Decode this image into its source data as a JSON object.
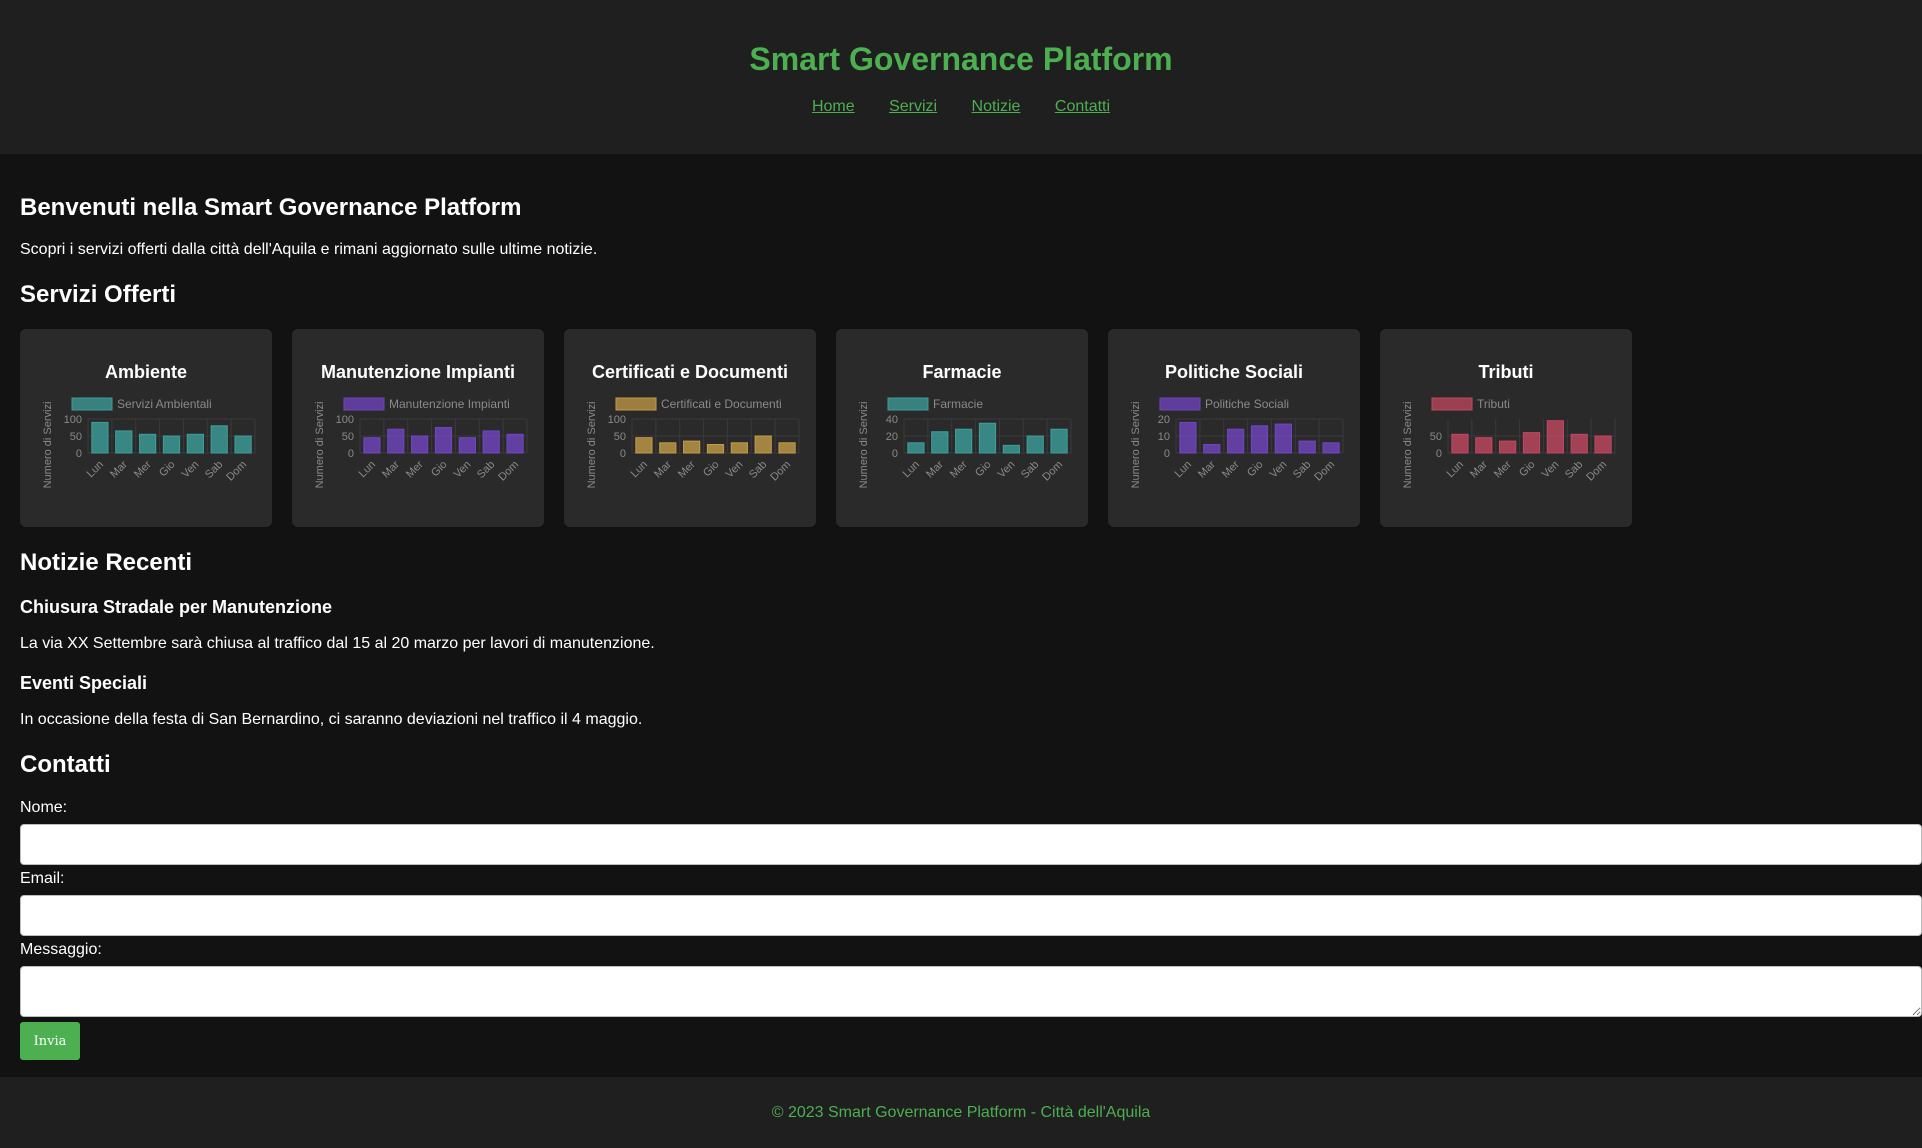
{
  "header": {
    "title": "Smart Governance Platform",
    "nav": [
      "Home",
      "Servizi",
      "Notizie",
      "Contatti"
    ]
  },
  "welcome": {
    "title": "Benvenuti nella Smart Governance Platform",
    "text": "Scopri i servizi offerti dalla città dell'Aquila e rimani aggiornato sulle ultime notizie."
  },
  "services": {
    "title": "Servizi Offerti",
    "cards": [
      {
        "title": "Ambiente"
      },
      {
        "title": "Manutenzione Impianti"
      },
      {
        "title": "Certificati e Documenti"
      },
      {
        "title": "Farmacie"
      },
      {
        "title": "Politiche Sociali"
      },
      {
        "title": "Tributi"
      }
    ]
  },
  "chart_data": [
    {
      "type": "bar",
      "title": "",
      "ylabel": "Numero di Servizi",
      "categories": [
        "Lun",
        "Mar",
        "Mer",
        "Gio",
        "Ven",
        "Sab",
        "Dom"
      ],
      "series": [
        {
          "name": "Servizi Ambientali",
          "values": [
            90,
            65,
            55,
            50,
            55,
            80,
            50
          ]
        }
      ],
      "yticks": [
        0,
        50,
        100
      ],
      "ylim": [
        0,
        100
      ],
      "color": "#3d9f9b"
    },
    {
      "type": "bar",
      "title": "",
      "ylabel": "Numero di Servizi",
      "categories": [
        "Lun",
        "Mar",
        "Mer",
        "Gio",
        "Ven",
        "Sab",
        "Dom"
      ],
      "series": [
        {
          "name": "Manutenzione Impianti",
          "values": [
            45,
            70,
            50,
            75,
            45,
            65,
            55
          ]
        }
      ],
      "yticks": [
        0,
        50,
        100
      ],
      "ylim": [
        0,
        100
      ],
      "color": "#7046c0"
    },
    {
      "type": "bar",
      "title": "",
      "ylabel": "Numero di Servizi",
      "categories": [
        "Lun",
        "Mar",
        "Mer",
        "Gio",
        "Ven",
        "Sab",
        "Dom"
      ],
      "series": [
        {
          "name": "Certificati e Documenti",
          "values": [
            45,
            30,
            35,
            25,
            30,
            50,
            30
          ]
        }
      ],
      "yticks": [
        0,
        50,
        100
      ],
      "ylim": [
        0,
        100
      ],
      "color": "#c39b47"
    },
    {
      "type": "bar",
      "title": "",
      "ylabel": "Numero di Servizi",
      "categories": [
        "Lun",
        "Mar",
        "Mer",
        "Gio",
        "Ven",
        "Sab",
        "Dom"
      ],
      "series": [
        {
          "name": "Farmacie",
          "values": [
            12,
            25,
            28,
            35,
            9,
            20,
            28
          ]
        }
      ],
      "yticks": [
        0,
        20,
        40
      ],
      "ylim": [
        0,
        40
      ],
      "color": "#3d9f9b"
    },
    {
      "type": "bar",
      "title": "",
      "ylabel": "Numero di Servizi",
      "categories": [
        "Lun",
        "Mar",
        "Mer",
        "Gio",
        "Ven",
        "Sab",
        "Dom"
      ],
      "series": [
        {
          "name": "Politiche Sociali",
          "values": [
            18,
            5,
            14,
            16,
            17,
            7,
            6
          ]
        }
      ],
      "yticks": [
        0,
        10,
        20
      ],
      "ylim": [
        0,
        20
      ],
      "color": "#7046c0"
    },
    {
      "type": "bar",
      "title": "",
      "ylabel": "Numero di Servizi",
      "categories": [
        "Lun",
        "Mar",
        "Mer",
        "Gio",
        "Ven",
        "Sab",
        "Dom"
      ],
      "series": [
        {
          "name": "Tributi",
          "values": [
            55,
            45,
            35,
            60,
            95,
            55,
            50
          ]
        }
      ],
      "yticks": [
        0,
        50
      ],
      "ylim": [
        0,
        100
      ],
      "color": "#c2485f"
    }
  ],
  "news": {
    "title": "Notizie Recenti",
    "items": [
      {
        "title": "Chiusura Stradale per Manutenzione",
        "text": "La via XX Settembre sarà chiusa al traffico dal 15 al 20 marzo per lavori di manutenzione."
      },
      {
        "title": "Eventi Speciali",
        "text": "In occasione della festa di San Bernardino, ci saranno deviazioni nel traffico il 4 maggio."
      }
    ]
  },
  "contact": {
    "title": "Contatti",
    "name_label": "Nome:",
    "email_label": "Email:",
    "message_label": "Messaggio:",
    "submit_label": "Invia"
  },
  "footer": {
    "text": "© 2023 Smart Governance Platform - Città dell'Aquila"
  }
}
